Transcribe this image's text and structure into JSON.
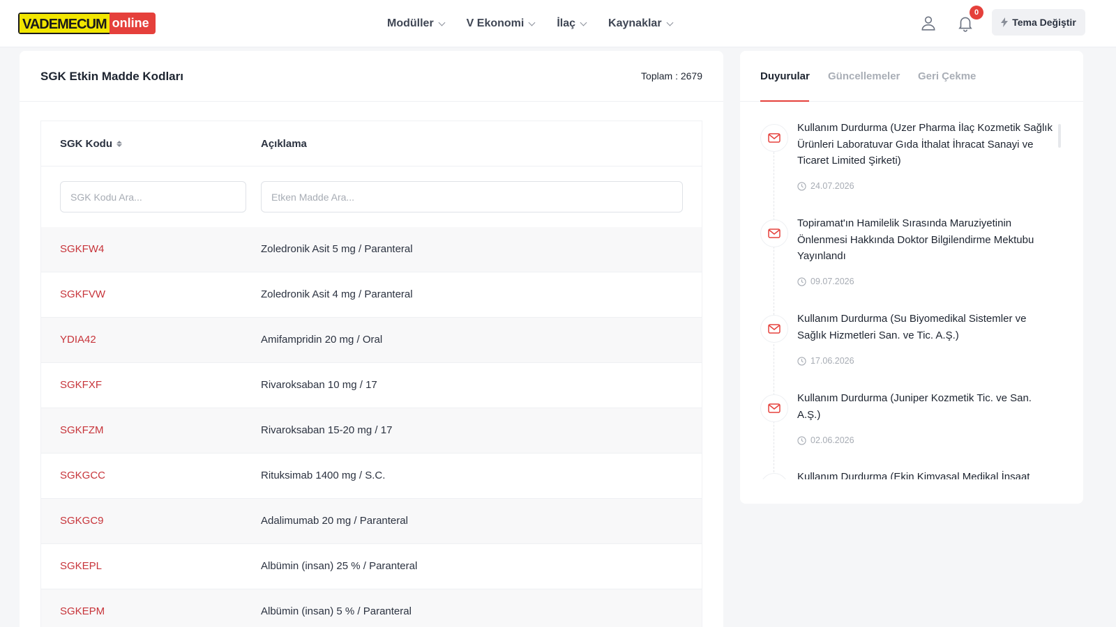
{
  "header": {
    "logo_part1": "VADEMECUM",
    "logo_part2": "online",
    "nav": [
      "Modüller",
      "V Ekonomi",
      "İlaç",
      "Kaynaklar"
    ],
    "notification_count": "0",
    "theme_button": "Tema Değiştir"
  },
  "main": {
    "title": "SGK Etkin Madde Kodları",
    "total": "Toplam : 2679",
    "columns": {
      "code": "SGK Kodu",
      "description": "Açıklama"
    },
    "filters": {
      "code_placeholder": "SGK Kodu Ara...",
      "description_placeholder": "Etken Madde Ara..."
    },
    "rows": [
      {
        "code": "SGKFW4",
        "description": "Zoledronik Asit 5 mg / Paranteral"
      },
      {
        "code": "SGKFVW",
        "description": "Zoledronik Asit 4 mg / Paranteral"
      },
      {
        "code": "YDIA42",
        "description": "Amifampridin 20 mg / Oral"
      },
      {
        "code": "SGKFXF",
        "description": "Rivaroksaban 10 mg / 17"
      },
      {
        "code": "SGKFZM",
        "description": "Rivaroksaban 15-20 mg / 17"
      },
      {
        "code": "SGKGCC",
        "description": "Rituksimab 1400 mg / S.C."
      },
      {
        "code": "SGKGC9",
        "description": "Adalimumab 20 mg / Paranteral"
      },
      {
        "code": "SGKEPL",
        "description": "Albümin (insan) 25 % / Paranteral"
      },
      {
        "code": "SGKEPM",
        "description": "Albümin (insan) 5 % / Paranteral"
      }
    ]
  },
  "sidebar": {
    "tabs": [
      "Duyurular",
      "Güncellemeler",
      "Geri Çekme"
    ],
    "active_tab": "Duyurular",
    "announcements": [
      {
        "title": "Kullanım Durdurma (Uzer Pharma İlaç Kozmetik Sağlık Ürünleri Laboratuvar Gıda İthalat İhracat Sanayi ve Ticaret Limited Şirketi)",
        "date": "24.07.2026"
      },
      {
        "title": "Topiramat'ın Hamilelik Sırasında Maruziyetinin Önlenmesi Hakkında Doktor Bilgilendirme Mektubu Yayınlandı",
        "date": "09.07.2026"
      },
      {
        "title": "Kullanım Durdurma (Su Biyomedikal Sistemler ve Sağlık Hizmetleri San. ve Tic. A.Ş.)",
        "date": "17.06.2026"
      },
      {
        "title": "Kullanım Durdurma (Juniper Kozmetik Tic. ve San. A.Ş.)",
        "date": "02.06.2026"
      },
      {
        "title": "Kullanım Durdurma (Ekin Kimyasal Medikal İnşaat",
        "date": ""
      }
    ]
  },
  "colors": {
    "accent": "#e5403b",
    "code_link": "#c7343a",
    "logo_yellow": "#f2e600"
  },
  "icons": [
    "user-icon",
    "bell-icon",
    "bolt-icon",
    "sort-icon",
    "mail-icon",
    "clock-icon",
    "chevron-down-icon"
  ]
}
